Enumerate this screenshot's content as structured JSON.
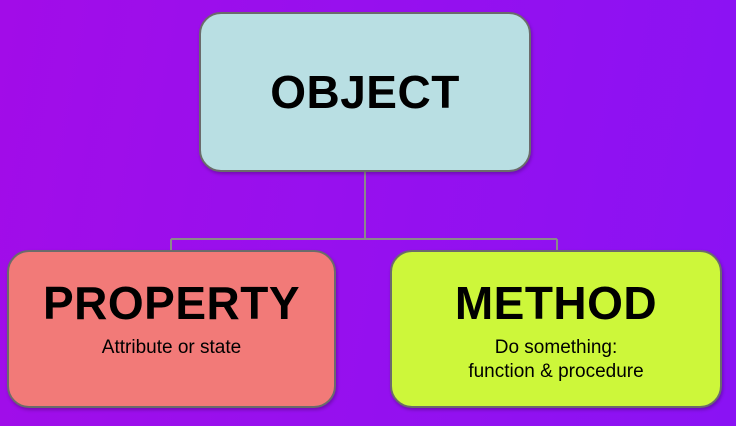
{
  "diagram": {
    "root": {
      "title": "OBJECT"
    },
    "children": [
      {
        "title": "PROPERTY",
        "description": "Attribute or state"
      },
      {
        "title": "METHOD",
        "description_line1": "Do something:",
        "description_line2": "function & procedure"
      }
    ]
  },
  "colors": {
    "background": "#9710ee",
    "object_fill": "#b9dfe3",
    "property_fill": "#f27a78",
    "method_fill": "#cdf73a",
    "border": "#6b6b6b"
  }
}
